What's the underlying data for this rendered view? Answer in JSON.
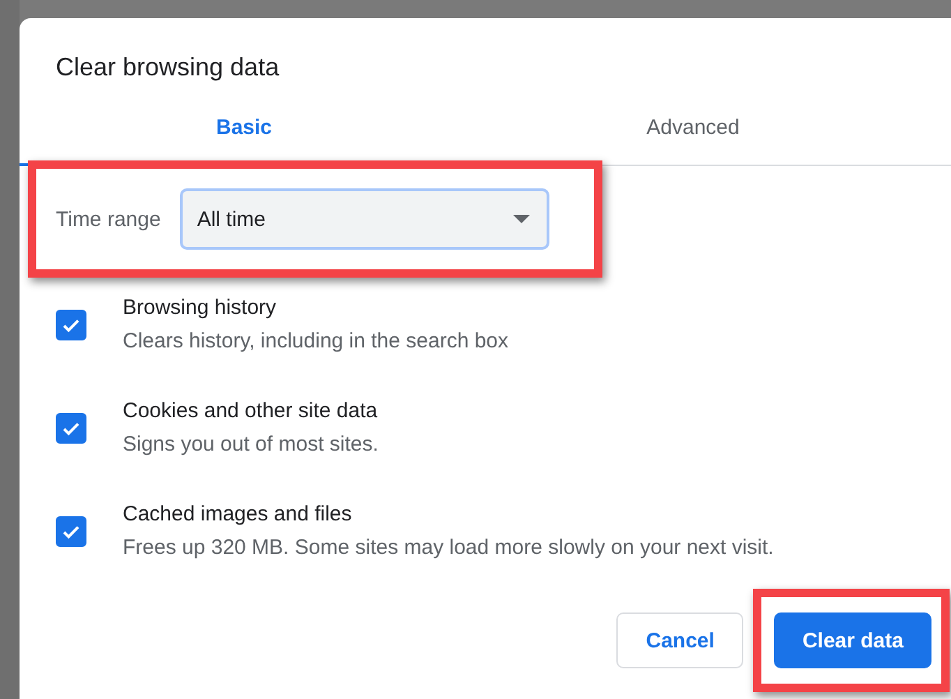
{
  "dialog": {
    "title": "Clear browsing data"
  },
  "tabs": [
    {
      "label": "Basic",
      "selected": true
    },
    {
      "label": "Advanced",
      "selected": false
    }
  ],
  "time_range": {
    "label": "Time range",
    "value": "All time",
    "highlighted": true
  },
  "options": [
    {
      "title": "Browsing history",
      "description": "Clears history, including in the search box",
      "checked": true
    },
    {
      "title": "Cookies and other site data",
      "description": "Signs you out of most sites.",
      "checked": true
    },
    {
      "title": "Cached images and files",
      "description": "Frees up 320 MB. Some sites may load more slowly on your next visit.",
      "checked": true
    }
  ],
  "buttons": [
    {
      "label": "Cancel",
      "kind": "secondary",
      "highlighted": false
    },
    {
      "label": "Clear data",
      "kind": "primary",
      "highlighted": true
    }
  ]
}
